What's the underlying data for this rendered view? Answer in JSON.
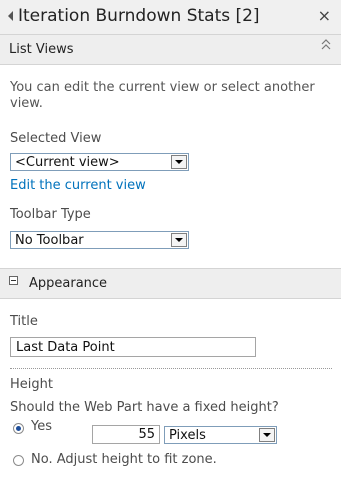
{
  "header": {
    "title": "Iteration Burndown Stats [2]",
    "close_glyph": "×"
  },
  "list_views": {
    "section_label": "List Views",
    "description": "You can edit the current view or select another view.",
    "selected_view_label": "Selected View",
    "selected_view_value": "<Current view>",
    "edit_link": "Edit the current view",
    "toolbar_type_label": "Toolbar Type",
    "toolbar_type_value": "No Toolbar"
  },
  "appearance": {
    "section_label": "Appearance",
    "title_label": "Title",
    "title_value": "Last Data Point",
    "height_label": "Height",
    "height_question": "Should the Web Part have a fixed height?",
    "yes_label": "Yes",
    "height_value": "55",
    "unit_value": "Pixels",
    "no_label": "No. Adjust height to fit zone."
  },
  "icons": {
    "collapse": "double-chevron-up-icon",
    "section_toggle": "minus-box-icon",
    "header_arrow": "triangle-left-icon"
  },
  "colors": {
    "link": "#0072bc",
    "header_bg": "#f0f0f0",
    "section_bg": "#eeeeee"
  }
}
